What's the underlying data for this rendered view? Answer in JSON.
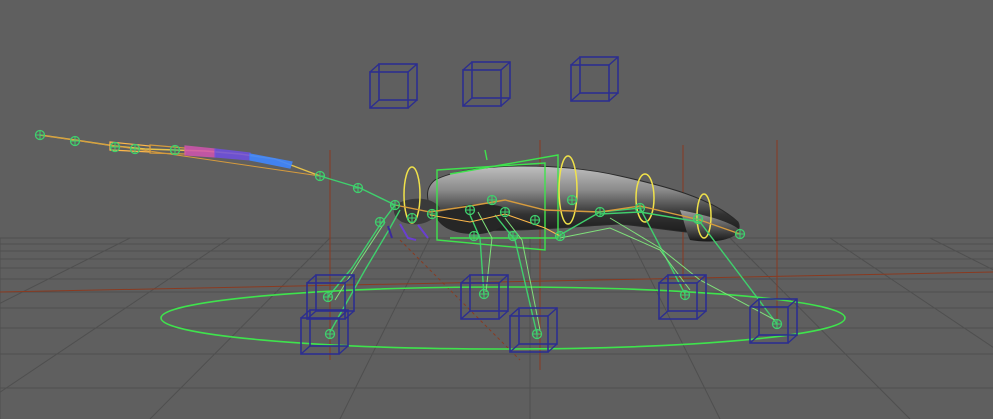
{
  "viewport": {
    "name": "3D viewport",
    "background": "#5f5f5f",
    "grid_color": "#4d4d4d",
    "axis_color": "#8a3a20",
    "mesh": "beetle",
    "rig_colors": {
      "joint": "#3fd06d",
      "ik_control": "#2c2e8f",
      "rotate_control": "#f0e24a",
      "main_control": "#3fe34d",
      "antenna_chain": [
        "#ffb84a",
        "#d69b3d",
        "#d255b0",
        "#6f4fe3",
        "#3f86ff"
      ]
    }
  }
}
